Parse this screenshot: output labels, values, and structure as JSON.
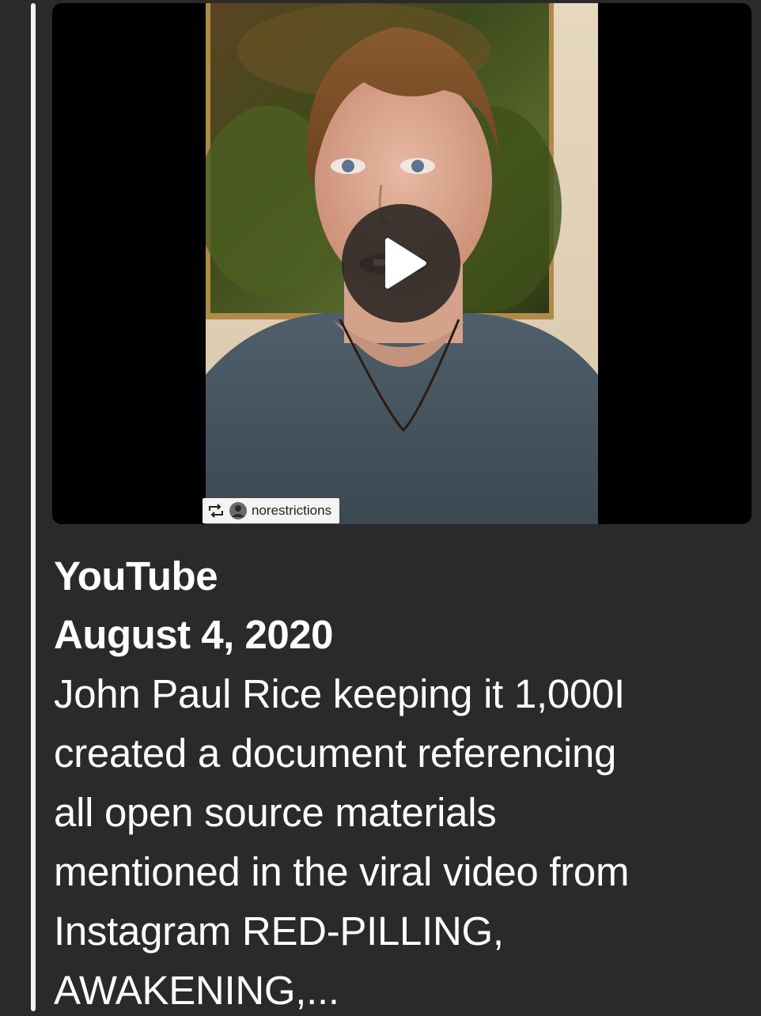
{
  "link_preview": {
    "source": "YouTube",
    "date": "August 4, 2020",
    "description": "John Paul Rice keeping it 1,000I\ncreated a document referencing\nall open source materials\nmentioned in the viral video from\nInstagram RED-PILLING,\nAWAKENING,...",
    "thumbnail": {
      "play_icon": "play-icon",
      "watermark": {
        "repost_icon": "repost-icon",
        "username": "norestrictions"
      }
    }
  },
  "colors": {
    "background": "#2a2a2c",
    "text": "#ffffff",
    "quote_bar": "#f2f2f2"
  }
}
